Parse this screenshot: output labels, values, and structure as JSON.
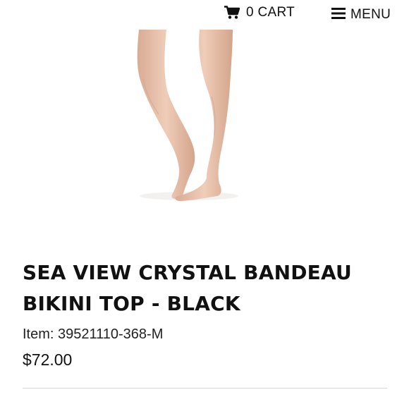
{
  "header": {
    "cart_label": "0 CART",
    "menu_label": "MENU"
  },
  "product": {
    "title_line1": "SEA VIEW CRYSTAL BANDEAU",
    "title_line2": "BIKINI TOP - BLACK",
    "item_label": "Item: 39521110-368-M",
    "price": "$72.00"
  },
  "icons": {
    "cart": "cart-icon",
    "menu": "hamburger-icon"
  },
  "colors": {
    "text": "#111111",
    "divider": "#d7d7d7",
    "background": "#ffffff"
  }
}
